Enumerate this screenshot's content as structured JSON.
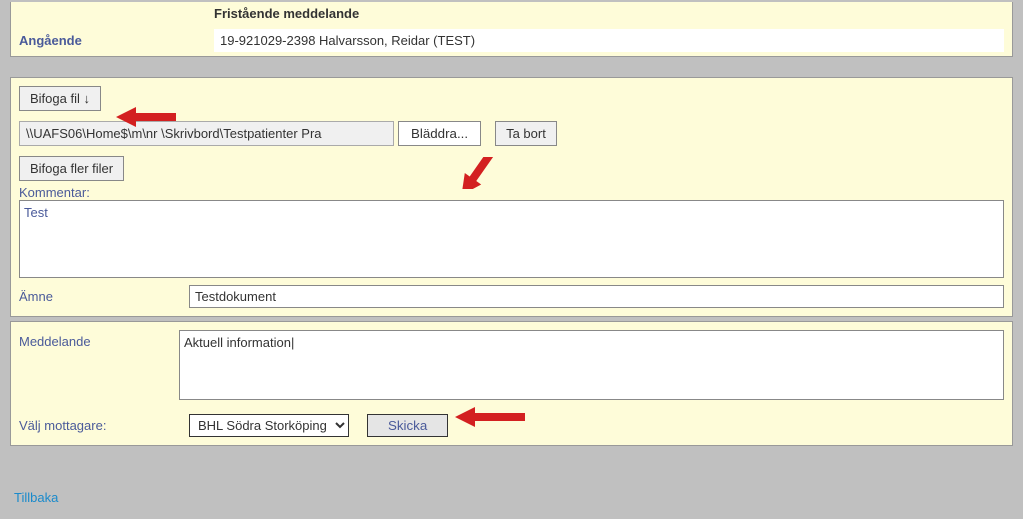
{
  "header": {
    "title": "Fristående meddelande",
    "about_label": "Angående",
    "about_value": "19-921029-2398    Halvarsson,  Reidar (TEST)"
  },
  "attach": {
    "attach_button": "Bifoga fil ↓",
    "file_path": "\\\\UAFS06\\Home$\\m\\nr               \\Skrivbord\\Testpatienter Pra",
    "browse_button": "Bläddra...",
    "remove_button": "Ta bort",
    "more_files_button": "Bifoga fler filer",
    "comment_label": "Kommentar:",
    "comment_value": "Test",
    "subject_label": "Ämne",
    "subject_value": "Testdokument"
  },
  "message": {
    "label": "Meddelande",
    "value": "Aktuell information|",
    "recipient_label": "Välj mottagare:",
    "recipient_value": "BHL Södra Storköping",
    "send_button": "Skicka"
  },
  "footer": {
    "back_link": "Tillbaka"
  }
}
